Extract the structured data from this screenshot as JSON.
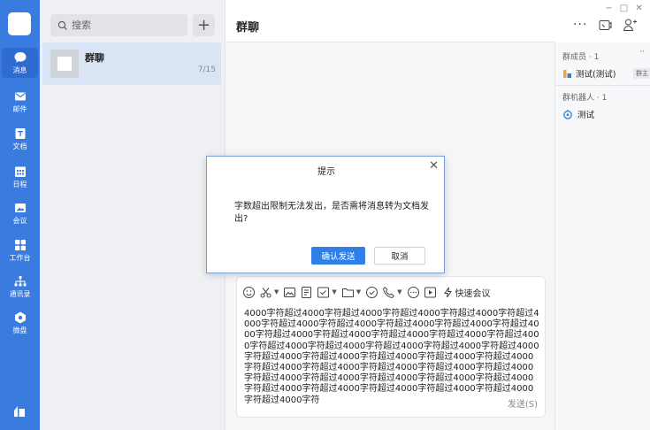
{
  "nav": {
    "items": [
      {
        "label": "消息",
        "icon": "chat-bubble-icon",
        "active": true
      },
      {
        "label": "邮件",
        "icon": "mail-icon"
      },
      {
        "label": "文档",
        "icon": "document-icon"
      },
      {
        "label": "日程",
        "icon": "calendar-icon"
      },
      {
        "label": "会议",
        "icon": "meeting-icon"
      },
      {
        "label": "工作台",
        "icon": "workbench-icon"
      },
      {
        "label": "通讯录",
        "icon": "contacts-icon"
      },
      {
        "label": "微盘",
        "icon": "drive-icon"
      }
    ]
  },
  "list": {
    "search_placeholder": "搜索",
    "add_label": "+",
    "session": {
      "name": "群聊",
      "count": "7/15"
    }
  },
  "chat": {
    "title": "群聊",
    "more_label": "···",
    "quick_meeting": "快速会议",
    "message": "4000字符超过4000字符超过4000字符超过4000字符超过4000字符超过4000字符超过4000字符超过4000字符超过4000字符超过4000字符超过4000字符超过4000字符超过4000字符超过4000字符超过4000字符超过4000字符超过4000字符超过4000字符超过4000字符超过4000字符超过4000字符超过4000字符超过4000字符超过4000字符超过4000字符超过4000字符超过4000字符超过4000字符超过4000字符超过4000字符超过4000字符超过4000字符超过4000字符超过4000字符超过4000字符超过4000字符超过4000字符超过4000字符超过4000字符超过4000字符超过4000字符超过4000字符",
    "send_label": "发送(S)"
  },
  "panel": {
    "members_title": "群成员 · 1",
    "member_name": "测试(测试)",
    "member_badge": "群主",
    "robots_title": "群机器人 · 1",
    "robot_name": "测试",
    "more_dots": "··"
  },
  "window": {
    "minimize": "−",
    "maximize": "□",
    "close": "✕"
  },
  "dialog": {
    "title": "提示",
    "message": "字数超出限制无法发出，是否需将消息转为文档发出?",
    "confirm_label": "确认发送",
    "cancel_label": "取消",
    "close_label": "✕"
  },
  "colors": {
    "nav_bg": "#3a7bdf",
    "accent": "#2f7fe6"
  }
}
